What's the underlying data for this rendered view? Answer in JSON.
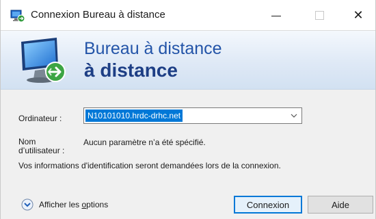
{
  "window": {
    "title": "Connexion Bureau à distance",
    "minimize_icon": "minimize-icon",
    "maximize_icon": "maximize-icon",
    "close_icon": "close-icon",
    "close_glyph": "✕"
  },
  "banner": {
    "line1": "Bureau à distance",
    "line2": "à distance",
    "icon": "remote-desktop-monitor-icon"
  },
  "form": {
    "computer_label": "Ordinateur :",
    "computer_value": "N10101010.hrdc-drhc.net",
    "username_label_line1": "Nom",
    "username_label_line2": "d’utilisateur :",
    "username_value": "Aucun paramètre n’a été spécifié.",
    "info_text": "Vos informations d'identification seront demandées lors de la connexion."
  },
  "footer": {
    "options_prefix": "Afficher les ",
    "options_accel": "o",
    "options_suffix": "ptions",
    "connect_label": "Connexion",
    "help_label": "Aide"
  },
  "colors": {
    "accent": "#0078d7",
    "banner_text": "#2354a8",
    "banner_bold": "#1d3e85"
  }
}
